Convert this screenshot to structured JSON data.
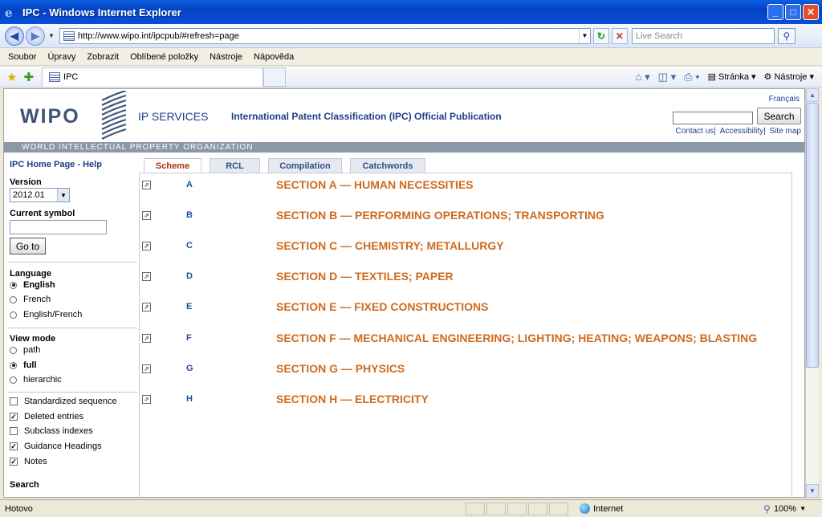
{
  "window": {
    "title": "IPC - Windows Internet Explorer",
    "url": "http://www.wipo.int/ipcpub/#refresh=page",
    "search_placeholder": "Live Search"
  },
  "menu": [
    "Soubor",
    "Úpravy",
    "Zobrazit",
    "Oblíbené položky",
    "Nástroje",
    "Nápověda"
  ],
  "tab": {
    "label": "IPC"
  },
  "commands": {
    "page": "Stránka",
    "tools": "Nástroje"
  },
  "status": {
    "text": "Hotovo",
    "zone": "Internet",
    "zoom": "100%"
  },
  "header": {
    "logo": "WIPO",
    "services": "IP SERVICES",
    "publication": "International Patent Classification (IPC) Official Publication",
    "francais": "Français",
    "search_button": "Search",
    "links": [
      "Contact us",
      "Accessibility",
      "Site map"
    ],
    "band": "WORLD INTELLECTUAL PROPERTY ORGANIZATION"
  },
  "leftnav": {
    "home": "IPC Home Page",
    "help": "Help",
    "version_label": "Version",
    "version_value": "2012.01",
    "symbol_label": "Current symbol",
    "goto": "Go to",
    "language_label": "Language",
    "languages": [
      {
        "label": "English",
        "selected": true
      },
      {
        "label": "French",
        "selected": false
      },
      {
        "label": "English/French",
        "selected": false
      }
    ],
    "viewmode_label": "View mode",
    "viewmodes": [
      {
        "label": "path",
        "selected": false
      },
      {
        "label": "full",
        "selected": true
      },
      {
        "label": "hierarchic",
        "selected": false
      }
    ],
    "options": [
      {
        "label": "Standardized sequence",
        "checked": false
      },
      {
        "label": "Deleted entries",
        "checked": true
      },
      {
        "label": "Subclass indexes",
        "checked": false
      },
      {
        "label": "Guidance Headings",
        "checked": true
      },
      {
        "label": "Notes",
        "checked": true
      }
    ],
    "search_label": "Search"
  },
  "tabs": [
    "Scheme",
    "RCL",
    "Compilation",
    "Catchwords"
  ],
  "sections": [
    {
      "letter": "A",
      "title": "SECTION A — HUMAN NECESSITIES"
    },
    {
      "letter": "B",
      "title": "SECTION B — PERFORMING OPERATIONS; TRANSPORTING"
    },
    {
      "letter": "C",
      "title": "SECTION C — CHEMISTRY; METALLURGY"
    },
    {
      "letter": "D",
      "title": "SECTION D — TEXTILES; PAPER"
    },
    {
      "letter": "E",
      "title": "SECTION E — FIXED CONSTRUCTIONS"
    },
    {
      "letter": "F",
      "title": "SECTION F — MECHANICAL ENGINEERING; LIGHTING; HEATING; WEAPONS; BLASTING"
    },
    {
      "letter": "G",
      "title": "SECTION G — PHYSICS"
    },
    {
      "letter": "H",
      "title": "SECTION H — ELECTRICITY"
    }
  ]
}
